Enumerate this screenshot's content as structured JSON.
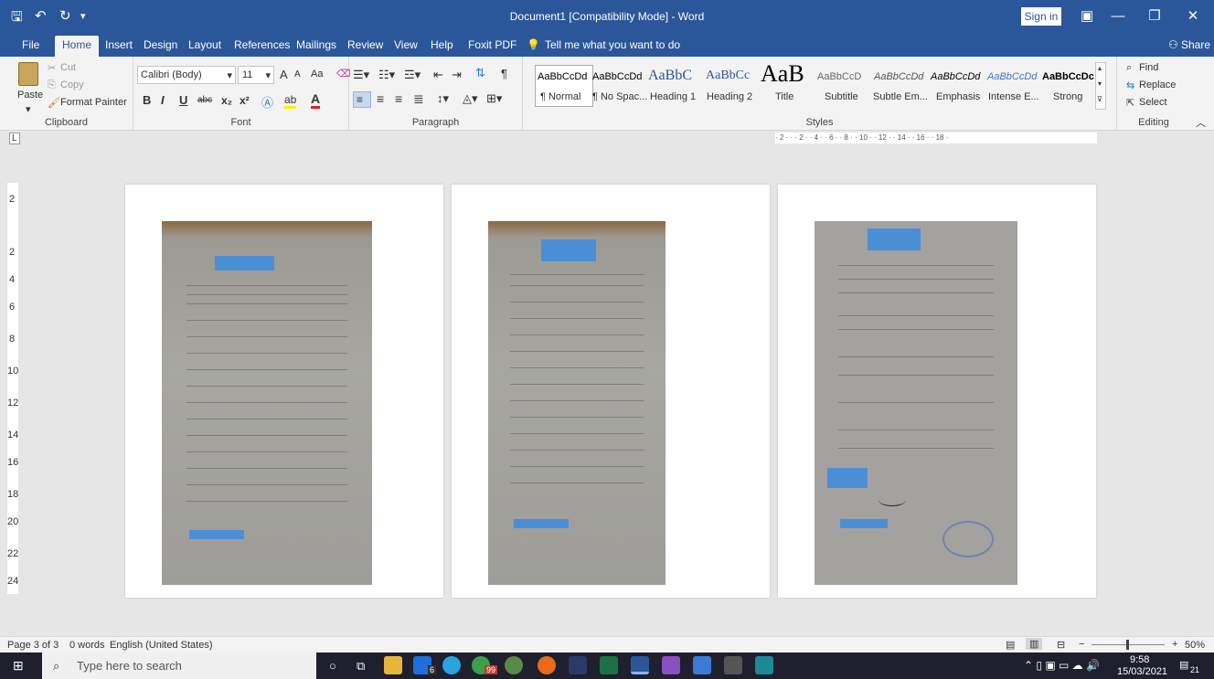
{
  "window": {
    "title": "Document1 [Compatibility Mode] - Word",
    "sign_in": "Sign in",
    "share": "Share"
  },
  "tabs": [
    "File",
    "Home",
    "Insert",
    "Design",
    "Layout",
    "References",
    "Mailings",
    "Review",
    "View",
    "Help",
    "Foxit PDF"
  ],
  "tell_me": "Tell me what you want to do",
  "clipboard": {
    "paste": "Paste",
    "cut": "Cut",
    "copy": "Copy",
    "format_painter": "Format Painter",
    "label": "Clipboard"
  },
  "font": {
    "name": "Calibri (Body)",
    "size": "11",
    "label": "Font",
    "bold": "B",
    "italic": "I",
    "underline": "U",
    "strike": "abc",
    "sub": "x₂",
    "sup": "x²",
    "grow": "A",
    "shrink": "A",
    "change_case": "Aa",
    "font_color": "A",
    "highlight": "ab"
  },
  "paragraph": {
    "label": "Paragraph"
  },
  "styles": {
    "label": "Styles",
    "items": [
      {
        "preview": "AaBbCcDd",
        "name": "¶ Normal"
      },
      {
        "preview": "AaBbCcDd",
        "name": "¶ No Spac..."
      },
      {
        "preview": "AaBbC",
        "name": "Heading 1"
      },
      {
        "preview": "AaBbCc",
        "name": "Heading 2"
      },
      {
        "preview": "AaB",
        "name": "Title"
      },
      {
        "preview": "AaBbCcD",
        "name": "Subtitle"
      },
      {
        "preview": "AaBbCcDd",
        "name": "Subtle Em..."
      },
      {
        "preview": "AaBbCcDd",
        "name": "Emphasis"
      },
      {
        "preview": "AaBbCcDd",
        "name": "Intense E..."
      },
      {
        "preview": "AaBbCcDc",
        "name": "Strong"
      }
    ]
  },
  "editing": {
    "find": "Find",
    "replace": "Replace",
    "select": "Select",
    "label": "Editing"
  },
  "ruler": {
    "horizontal": "· 2 ·  ·  · 2 ·  · 4 ·  · 6 ·  · 8 ·  · 10 ·  · 12 ·  · 14 ·  · 16 ·  · 18 ·",
    "vertical": [
      "2",
      "2",
      "4",
      "6",
      "8",
      "10",
      "12",
      "14",
      "16",
      "18",
      "20",
      "22",
      "24"
    ]
  },
  "status": {
    "page": "Page 3 of 3",
    "words": "0 words",
    "language": "English (United States)",
    "zoom": "50%"
  },
  "taskbar": {
    "search": "Type here to search",
    "time": "9:58",
    "date": "15/03/2021",
    "notifications": "21",
    "badge_6": "6",
    "badge_99": "99"
  },
  "colors": {
    "word_blue": "#2b579a",
    "ribbon_bg": "#f3f3f3",
    "doc_bg": "#e6e6e6",
    "taskbar": "#1f1f2e",
    "redaction": "#4a8fd6"
  }
}
